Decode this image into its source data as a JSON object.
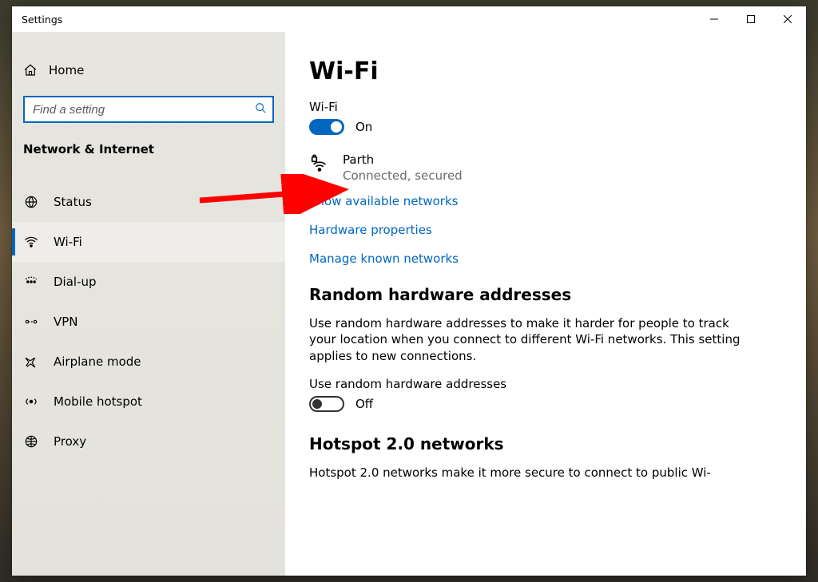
{
  "window": {
    "title": "Settings"
  },
  "sidebar": {
    "home_label": "Home",
    "search_placeholder": "Find a setting",
    "category_title": "Network & Internet",
    "items": [
      {
        "label": "Status",
        "icon": "status"
      },
      {
        "label": "Wi-Fi",
        "icon": "wifi",
        "active": true
      },
      {
        "label": "Dial-up",
        "icon": "dialup"
      },
      {
        "label": "VPN",
        "icon": "vpn"
      },
      {
        "label": "Airplane mode",
        "icon": "airplane"
      },
      {
        "label": "Mobile hotspot",
        "icon": "hotspot"
      },
      {
        "label": "Proxy",
        "icon": "proxy"
      }
    ]
  },
  "main": {
    "page_title": "Wi-Fi",
    "wifi": {
      "label": "Wi-Fi",
      "state": true,
      "state_text": "On"
    },
    "network": {
      "name": "Parth",
      "status": "Connected, secured"
    },
    "links": {
      "show_networks": "Show available networks",
      "hardware_props": "Hardware properties",
      "manage_known": "Manage known networks"
    },
    "random_hw": {
      "heading": "Random hardware addresses",
      "body": "Use random hardware addresses to make it harder for people to track your location when you connect to different Wi-Fi networks. This setting applies to new connections.",
      "toggle_label": "Use random hardware addresses",
      "state": false,
      "state_text": "Off"
    },
    "hotspot20": {
      "heading": "Hotspot 2.0 networks",
      "body": "Hotspot 2.0 networks make it more secure to connect to public Wi-"
    }
  }
}
